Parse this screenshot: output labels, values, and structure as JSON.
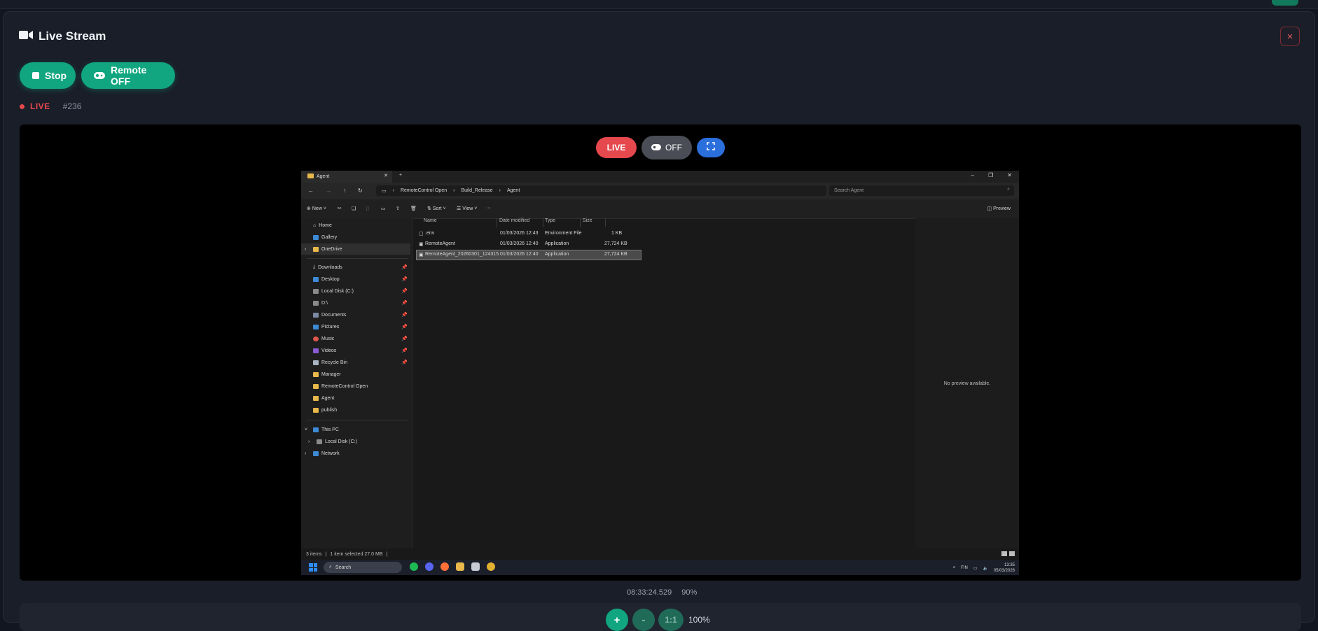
{
  "header": {
    "title": "Live Stream",
    "close_label": "×"
  },
  "controls": {
    "stop_label": "Stop",
    "remote_label": "Remote OFF"
  },
  "status": {
    "live_label": "LIVE",
    "session_number": "#236"
  },
  "viewer": {
    "live_pill": "LIVE",
    "remote_pill": "OFF"
  },
  "remote_screen": {
    "tab_title": "Agent",
    "breadcrumbs": [
      "RemoteControl Open",
      "Build_Release",
      "Agent"
    ],
    "search_placeholder": "Search Agent",
    "toolbar": {
      "new": "New",
      "sort": "Sort",
      "view": "View",
      "preview": "Preview"
    },
    "nav_top": [
      "Home",
      "Gallery",
      "OneDrive"
    ],
    "nav_quick": [
      "Downloads",
      "Desktop",
      "Local Disk (C:)",
      "D:\\",
      "Documents",
      "Pictures",
      "Music",
      "Videos",
      "Recycle Bin",
      "Manager",
      "RemoteControl Open",
      "Agent",
      "publish"
    ],
    "nav_bottom": [
      "This PC",
      "Local Disk (C:)",
      "Network"
    ],
    "columns": [
      "Name",
      "Date modified",
      "Type",
      "Size"
    ],
    "files": [
      {
        "name": ".env",
        "date": "01/03/2026 12:43",
        "type": "Environment File",
        "size": "1 KB"
      },
      {
        "name": "RemoteAgent",
        "date": "01/03/2026 12:40",
        "type": "Application",
        "size": "27,724 KB"
      },
      {
        "name": "RemoteAgent_20260301_124315",
        "date": "01/03/2026 12:40",
        "type": "Application",
        "size": "27,724 KB"
      }
    ],
    "preview_text": "No preview available.",
    "status_items": "3 items",
    "status_selected": "1 item selected  27.0 MB",
    "taskbar_search": "Search",
    "tray_lang": "FIN",
    "clock_time": "13:35",
    "clock_date": "05/03/2026"
  },
  "readout": {
    "timestamp": "08:33:24.529",
    "quality": "90%"
  },
  "zoom": {
    "plus": "+",
    "minus": "-",
    "reset": "1:1",
    "level": "100%"
  },
  "colors": {
    "accent": "#11a67f",
    "live": "#e5484d",
    "fullscreen": "#2b6fdd",
    "background": "#121621"
  }
}
